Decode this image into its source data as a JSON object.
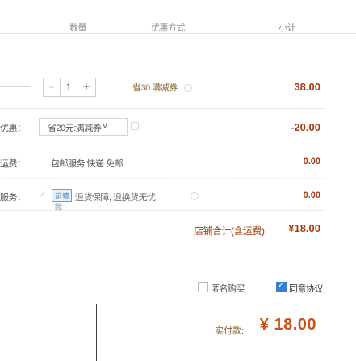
{
  "header": {
    "col_a": "数量",
    "col_b": "优惠方式",
    "col_c": "小计"
  },
  "item": {
    "qty_minus": "−",
    "qty_value": "1",
    "qty_plus": "+",
    "promo": "省30:满减券",
    "subtotal": "38.00"
  },
  "coupon": {
    "label": "优惠：",
    "selected": "省20元:满减券",
    "chevron": "∨",
    "amount": "-20.00"
  },
  "shipping": {
    "label": "运费：",
    "value": "包邮服务 快递 免邮",
    "amount": "0.00"
  },
  "service": {
    "label": "服务：",
    "icon_text": "运费险",
    "text": "退货保障, 退换货无忧",
    "amount": "0.00"
  },
  "summary": {
    "label": "店铺合计(含运费)",
    "amount": "¥18.00"
  },
  "options": {
    "anonymous_label": "匿名购买",
    "anonymous_checked": false,
    "agree_label": "同意协议",
    "agree_checked": true
  },
  "total": {
    "label": "实付款:",
    "value": "¥ 18.00"
  }
}
